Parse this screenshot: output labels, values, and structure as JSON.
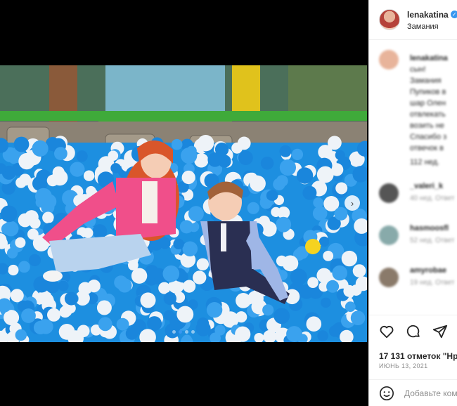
{
  "post": {
    "username": "lenakatina",
    "location": "Замания",
    "likes": "17 131 отметок \"Нра",
    "date": "ИЮНЬ 13, 2021",
    "add_comment_placeholder": "Добавьте ком"
  },
  "caption": {
    "lines": [
      "lenakatina",
      "сын! ",
      "Замания",
      "Пупиков в",
      "шар Олен",
      "отвлекать",
      "возить не",
      "Спасибо з",
      "отвечок в"
    ],
    "meta": "112 нед."
  },
  "comments": [
    {
      "name": "_valeri_k",
      "meta": "40 нед.   Ответ"
    },
    {
      "name": "hasmoosfl",
      "meta": "52 нед.   Ответ"
    },
    {
      "name": "amyrobae",
      "meta": "19 нед.   Ответ"
    }
  ],
  "colors": {
    "accent": "#3897f0",
    "ball_blue": "#1d8fe0",
    "jacket": "#f04f8a",
    "hair": "#d9562a"
  },
  "icons": {
    "like": "heart-icon",
    "comment": "comment-icon",
    "share": "share-icon",
    "emoji": "emoji-icon",
    "next": "chevron-right-icon"
  },
  "carousel": {
    "total": 4,
    "active": 2
  }
}
